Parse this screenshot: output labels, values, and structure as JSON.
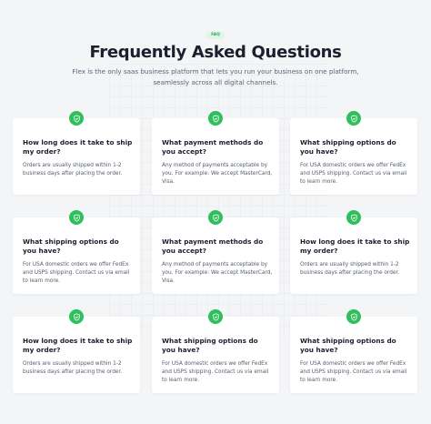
{
  "header": {
    "eyebrow": "FAQ",
    "title": "Frequently Asked Questions",
    "subtitle": "Flex is the only saas business platform that lets you run your business on one platform, seamlessly across all digital channels."
  },
  "accent_color": "#2fbf5c",
  "badge_icon": "shield-check-icon",
  "faqs": [
    {
      "question": "How long does it take to ship my order?",
      "answer": "Orders are usually shipped within 1-2 business days after placing the order."
    },
    {
      "question": "What payment methods do you accept?",
      "answer": "Any method of payments acceptable by you. For example: We accept MasterCard, Visa."
    },
    {
      "question": "What shipping options do you have?",
      "answer": "For USA domestic orders we offer FedEx and USPS shipping. Contact us via email to learn more."
    },
    {
      "question": "What shipping options do you have?",
      "answer": "For USA domestic orders we offer FedEx and USPS shipping. Contact us via email to learn more."
    },
    {
      "question": "What payment methods do you accept?",
      "answer": "Any method of payments acceptable by you. For example: We accept MasterCard, Visa."
    },
    {
      "question": "How long does it take to ship my order?",
      "answer": "Orders are usually shipped within 1-2 business days after placing the order."
    },
    {
      "question": "How long does it take to ship my order?",
      "answer": "Orders are usually shipped within 1-2 business days after placing the order."
    },
    {
      "question": "What shipping options do you have?",
      "answer": "For USA domestic orders we offer FedEx and USPS shipping. Contact us via email to learn more."
    },
    {
      "question": "What shipping options do you have?",
      "answer": "For USA domestic orders we offer FedEx and USPS shipping. Contact us via email to learn more."
    }
  ]
}
